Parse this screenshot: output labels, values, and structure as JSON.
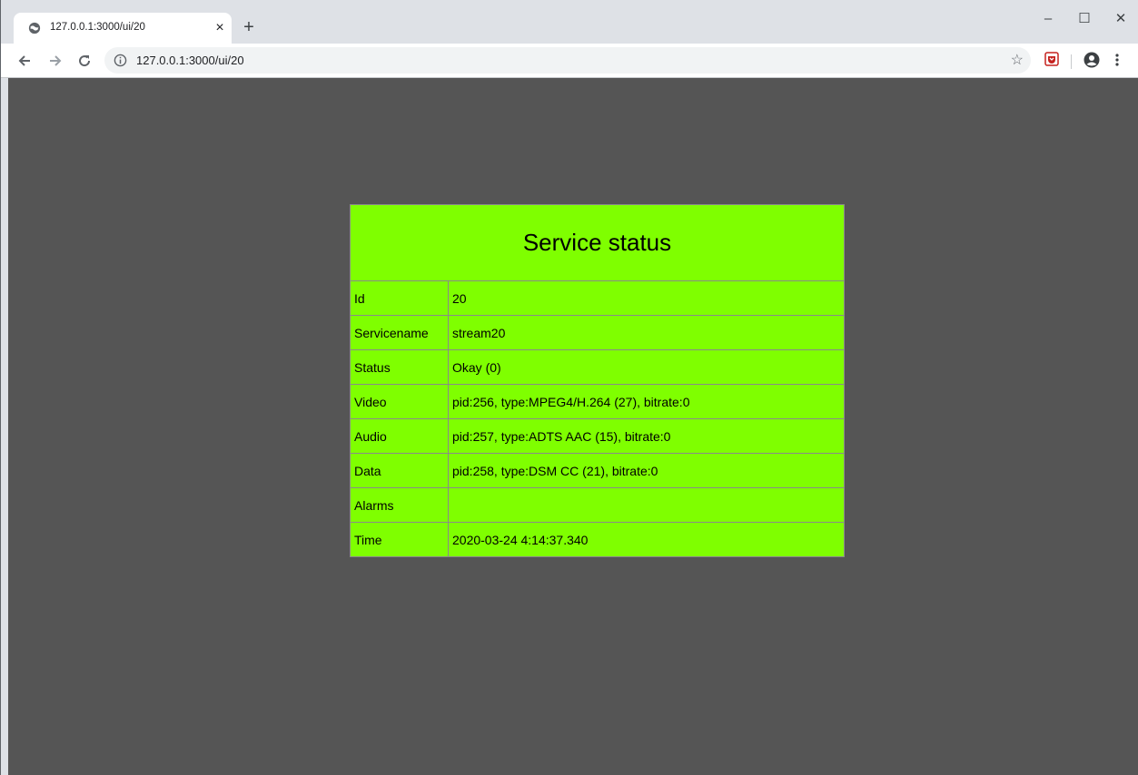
{
  "browser": {
    "tab_title": "127.0.0.1:3000/ui/20",
    "tab_close": "×",
    "new_tab": "+",
    "url": "127.0.0.1:3000/ui/20",
    "window_controls": {
      "minimize": "–",
      "maximize": "☐",
      "close": "✕"
    },
    "icons": [
      "globe-icon",
      "back-icon",
      "forward-icon",
      "reload-icon",
      "info-icon",
      "star-icon",
      "extension-icon",
      "profile-icon",
      "menu-icon"
    ]
  },
  "page": {
    "background": "#555555",
    "table_background": "#7fff00",
    "title": "Service status",
    "rows": [
      {
        "key": "Id",
        "value": "20"
      },
      {
        "key": "Servicename",
        "value": "stream20"
      },
      {
        "key": "Status",
        "value": "Okay (0)"
      },
      {
        "key": "Video",
        "value": "pid:256, type:MPEG4/H.264 (27), bitrate:0"
      },
      {
        "key": "Audio",
        "value": "pid:257, type:ADTS AAC (15), bitrate:0"
      },
      {
        "key": "Data",
        "value": "pid:258, type:DSM CC (21), bitrate:0"
      },
      {
        "key": "Alarms",
        "value": ""
      },
      {
        "key": "Time",
        "value": "2020-03-24 4:14:37.340"
      }
    ]
  }
}
